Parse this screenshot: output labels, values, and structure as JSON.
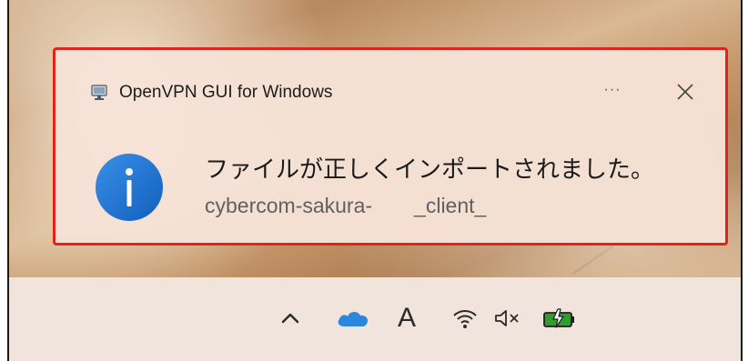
{
  "notification": {
    "app_name": "OpenVPN GUI for Windows",
    "more_label": "···",
    "close_icon": "close-icon",
    "title": "ファイルが正しくインポートされました。",
    "body": "cybercom-sakura-　　_client_",
    "info_icon": "info-icon",
    "app_icon": "openvpn-monitor-icon"
  },
  "taskbar": {
    "tray_items": [
      {
        "name": "show-hidden-icons",
        "icon": "chevron-up-icon"
      },
      {
        "name": "onedrive",
        "icon": "cloud-icon"
      },
      {
        "name": "input-indicator",
        "label": "A"
      },
      {
        "name": "wifi",
        "icon": "wifi-icon"
      },
      {
        "name": "volume-muted",
        "icon": "speaker-muted-icon"
      },
      {
        "name": "battery-charging",
        "icon": "battery-charging-icon"
      }
    ]
  },
  "colors": {
    "highlight_border": "#e0241c",
    "info_blue": "#1a6fd0",
    "onedrive_blue": "#2b86e0",
    "battery_green": "#2f9e2f"
  }
}
